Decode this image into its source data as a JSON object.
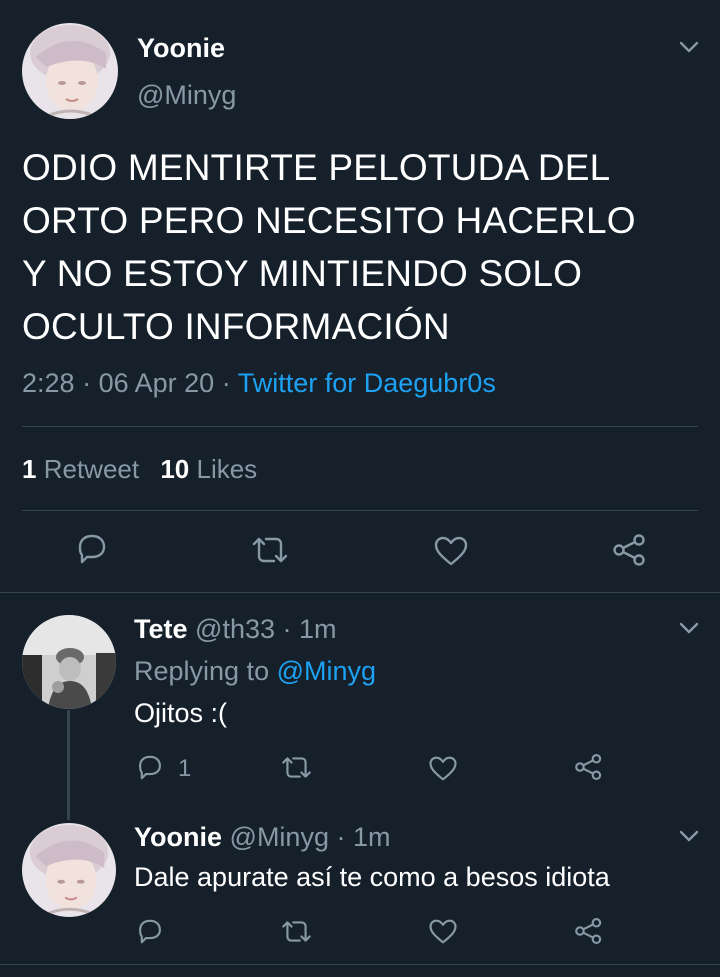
{
  "main_tweet": {
    "display_name": "Yoonie",
    "handle": "@Minyg",
    "text_lines": [
      "ODIO MENTIRTE PELOTUDA DEL",
      "ORTO PERO NECESITO HACERLO",
      "Y NO ESTOY MINTIENDO SOLO",
      "OCULTO INFORMACIÓN"
    ],
    "time": "2:28",
    "sep": "·",
    "date": "06 Apr 20",
    "source": "Twitter for Daegubr0s",
    "retweet_count": "1",
    "retweet_label": "Retweet",
    "like_count": "10",
    "like_label": "Likes"
  },
  "replies": [
    {
      "display_name": "Tete",
      "handle": "@th33",
      "time": "· 1m",
      "replying_prefix": "Replying to",
      "replying_handle": "@Minyg",
      "text": "Ojitos :(",
      "reply_count": "1"
    },
    {
      "display_name": "Yoonie",
      "handle": "@Minyg",
      "time": "· 1m",
      "text": "Dale apurate así te como a besos idiota"
    }
  ],
  "icons": [
    "chevron-down-icon",
    "reply-icon",
    "retweet-icon",
    "like-icon",
    "share-icon"
  ],
  "colors": {
    "background": "#15202b",
    "text": "#ffffff",
    "muted": "#8899a6",
    "accent": "#1da1f2",
    "divider": "#38444d"
  }
}
